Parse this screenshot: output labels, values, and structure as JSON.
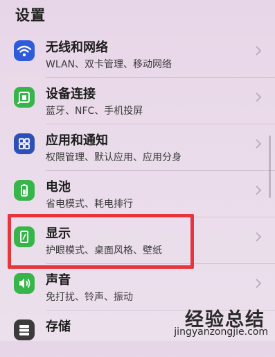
{
  "header": {
    "title": "设置"
  },
  "items": [
    {
      "title": "无线和网络",
      "subtitle": "WLAN、双卡管理、移动网络",
      "icon": "wifi-icon",
      "icon_color": "#2f5bd8"
    },
    {
      "title": "设备连接",
      "subtitle": "蓝牙、NFC、手机投屏",
      "icon": "device-connection-icon",
      "icon_color": "#36b54a"
    },
    {
      "title": "应用和通知",
      "subtitle": "权限管理、默认应用、应用分身",
      "icon": "apps-grid-icon",
      "icon_color": "#2f4fb8"
    },
    {
      "title": "电池",
      "subtitle": "省电模式、耗电排行",
      "icon": "battery-icon",
      "icon_color": "#36b54a"
    },
    {
      "title": "显示",
      "subtitle": "护眼模式、桌面风格、壁纸",
      "icon": "display-icon",
      "icon_color": "#36b54a"
    },
    {
      "title": "声音",
      "subtitle": "免打扰、铃声、振动",
      "icon": "sound-icon",
      "icon_color": "#36b54a"
    },
    {
      "title": "存储",
      "subtitle": "",
      "icon": "storage-icon",
      "icon_color": "#3b3b3b"
    }
  ],
  "highlight_color": "#e8343c",
  "watermark": {
    "text": "经验总结",
    "url": "jingyanzongjie.com"
  }
}
